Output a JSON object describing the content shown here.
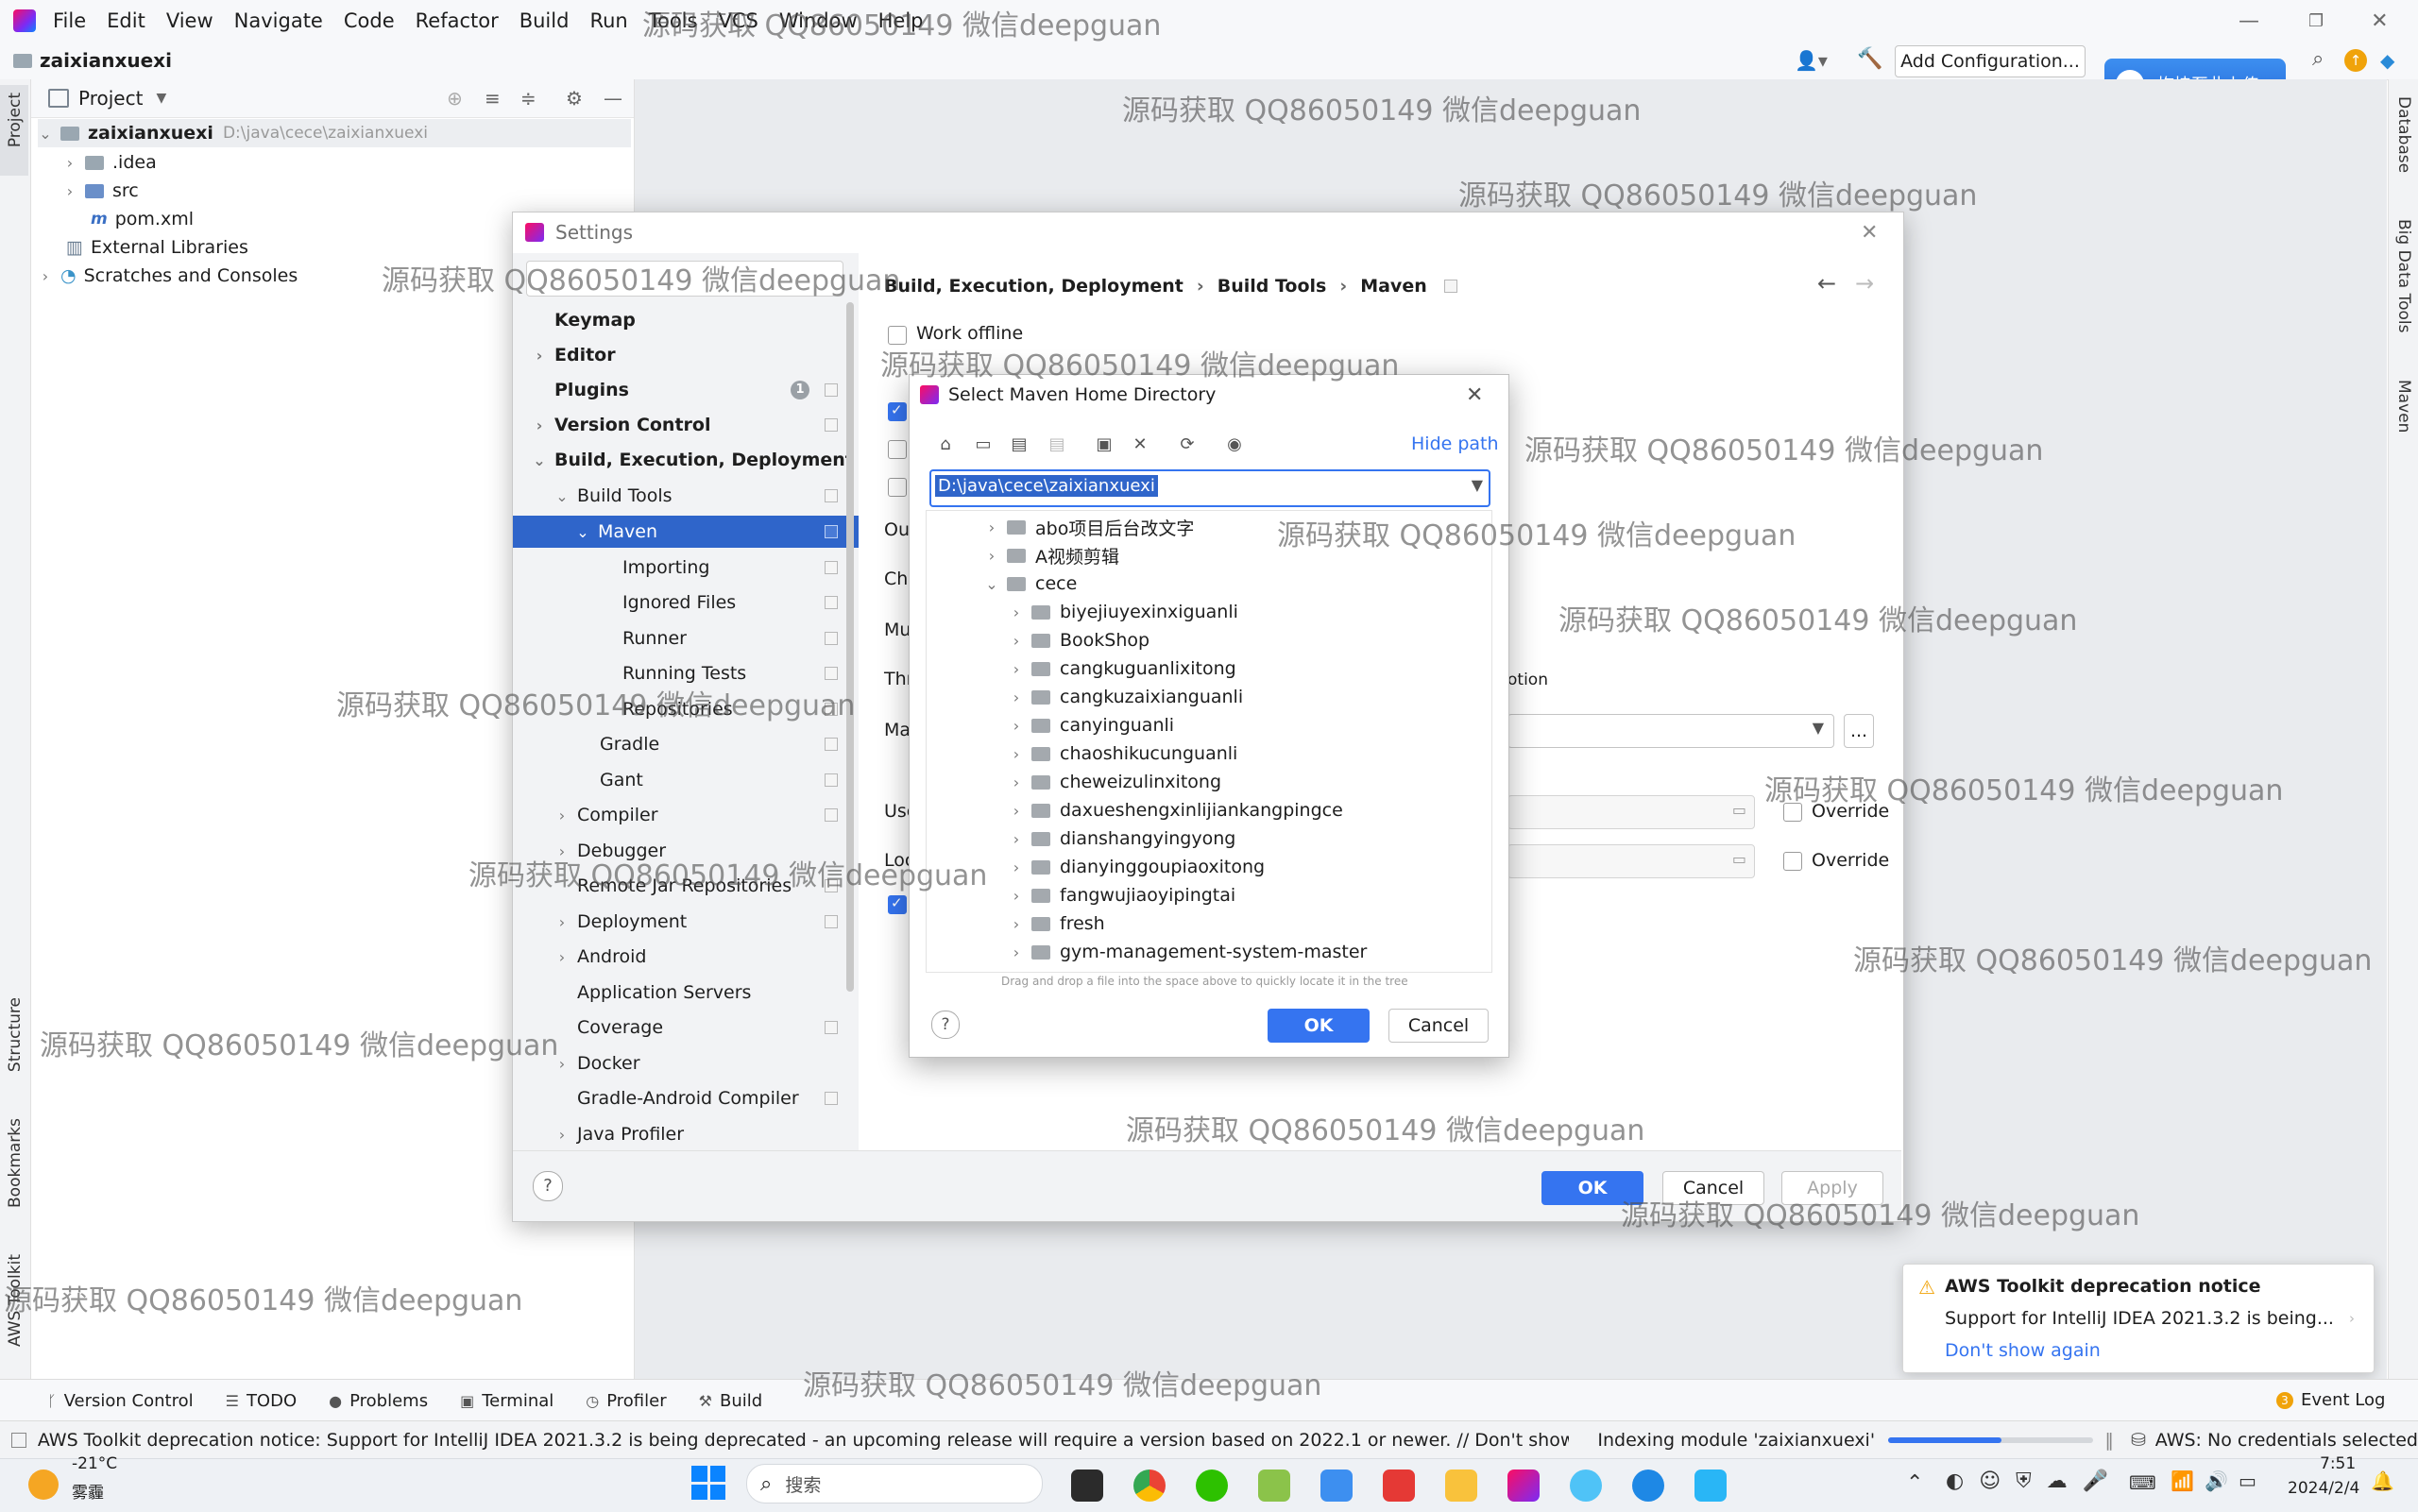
{
  "menubar": {
    "items": [
      "File",
      "Edit",
      "View",
      "Navigate",
      "Code",
      "Refactor",
      "Build",
      "Run",
      "Tools",
      "VCS",
      "Window",
      "Help"
    ]
  },
  "navbar": {
    "project_name": "zaixianxuexi",
    "add_configuration": "Add Configuration..."
  },
  "upload_widget": {
    "label": "拖拽至此上传"
  },
  "left_stripe": {
    "project": "Project",
    "structure": "Structure",
    "bookmarks": "Bookmarks",
    "aws_toolkit": "AWS Toolkit"
  },
  "right_stripe": {
    "database": "Database",
    "big_data_tools": "Big Data Tools",
    "maven": "Maven"
  },
  "project_panel": {
    "header": "Project",
    "root_name": "zaixianxuexi",
    "root_path": "D:\\java\\cece\\zaixianxuexi",
    "items": [
      ".idea",
      "src",
      "pom.xml",
      "External Libraries",
      "Scratches and Consoles"
    ]
  },
  "settings": {
    "title": "Settings",
    "breadcrumb": [
      "Build, Execution, Deployment",
      "Build Tools",
      "Maven"
    ],
    "nav": {
      "keymap": "Keymap",
      "editor": "Editor",
      "plugins": "Plugins",
      "version_control": "Version Control",
      "bed": "Build, Execution, Deployment",
      "build_tools": "Build Tools",
      "maven": "Maven",
      "importing": "Importing",
      "ignored_files": "Ignored Files",
      "runner": "Runner",
      "running_tests": "Running Tests",
      "repositories": "Repositories",
      "gradle": "Gradle",
      "gant": "Gant",
      "compiler": "Compiler",
      "debugger": "Debugger",
      "remote_jar": "Remote Jar Repositories",
      "deployment": "Deployment",
      "android": "Android",
      "app_servers": "Application Servers",
      "coverage": "Coverage",
      "docker": "Docker",
      "gradle_android": "Gradle-Android Compiler",
      "java_profiler": "Java Profiler"
    },
    "content": {
      "work_offline": "Work offline",
      "frag_output": "Ou",
      "frag_checksum": "Ch",
      "frag_multiproject": "Mu",
      "frag_thread": "Thr",
      "frag_maven_home": "Ma",
      "frag_user": "Use",
      "frag_local": "Loc",
      "frag_option": "otion",
      "override_1": "Override",
      "override_2": "Override",
      "browse": "..."
    },
    "buttons": {
      "ok": "OK",
      "cancel": "Cancel",
      "apply": "Apply"
    }
  },
  "maven_dialog": {
    "title": "Select Maven Home Directory",
    "hide_path": "Hide path",
    "path_value": "D:\\java\\cece\\zaixianxuexi",
    "tree": {
      "top_items": [
        "abo项目后台改文字",
        "A视频剪辑"
      ],
      "open_folder": "cece",
      "children": [
        "biyejiuyexinxiguanli",
        "BookShop",
        "cangkuguanlixitong",
        "cangkuzaixianguanli",
        "canyinguanli",
        "chaoshikucunguanli",
        "cheweizulinxitong",
        "daxueshengxinlijiankangpingce",
        "dianshangyingyong",
        "dianyinggoupiaoxitong",
        "fangwujiaoyipingtai",
        "fresh",
        "gym-management-system-master"
      ]
    },
    "hint": "Drag and drop a file into the space above to quickly locate it in the tree",
    "ok": "OK",
    "cancel": "Cancel"
  },
  "notification": {
    "title": "AWS Toolkit deprecation notice",
    "body": "Support for IntelliJ IDEA 2021.3.2 is being...",
    "link": "Don't show again"
  },
  "bottom_tabs": [
    "Version Control",
    "TODO",
    "Problems",
    "Terminal",
    "Profiler",
    "Build"
  ],
  "event_log": "Event Log",
  "status": {
    "message": "AWS Toolkit deprecation notice: Support for IntelliJ IDEA 2021.3.2 is being deprecated - an upcoming release will require a version based on 2022.1 or newer. // Don't show agai... (moments ac",
    "indexing": "Indexing module 'zaixianxuexi'",
    "indexing_progress": 0.55,
    "aws": "AWS: No credentials selected"
  },
  "taskbar": {
    "weather_temp": "-21°C",
    "weather_desc": "雾霾",
    "search_placeholder": "搜索",
    "time": "7:51",
    "date": "2024/2/4"
  },
  "watermark": "源码获取 QQ86050149 微信deepguan",
  "colors": {
    "accent": "#3574f0",
    "selection": "#2f65ca",
    "panel": "#f2f3f5"
  }
}
